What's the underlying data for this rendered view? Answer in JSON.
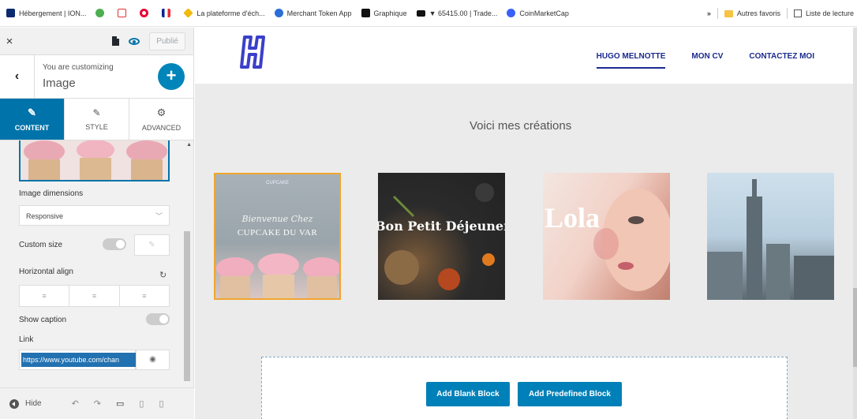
{
  "bookmarks": [
    {
      "label": "Hébergement | ION...",
      "icon": "ionos-icon",
      "color": "#0b2a6f"
    },
    {
      "label": "",
      "icon": "leaf-icon",
      "color": "#4caf50"
    },
    {
      "label": "",
      "icon": "spark-icon",
      "color": "#d33"
    },
    {
      "label": "",
      "icon": "opera-icon",
      "color": "#e03"
    },
    {
      "label": "",
      "icon": "flag-fr-icon",
      "color": "#002395"
    },
    {
      "label": "La plateforme d'éch...",
      "icon": "diamond-icon",
      "color": "#f0b90b"
    },
    {
      "label": "Merchant Token App",
      "icon": "merchant-icon",
      "color": "#2b6ed7"
    },
    {
      "label": "Graphique",
      "icon": "tradingview-icon",
      "color": "#111"
    },
    {
      "label": "▼ 65415.00 | Trade...",
      "icon": "trade-icon",
      "color": "#111"
    },
    {
      "label": "CoinMarketCap",
      "icon": "cmc-icon",
      "color": "#3861fb"
    }
  ],
  "bookmarks_right": {
    "more": "»",
    "other": "Autres favoris",
    "reading": "Liste de lecture"
  },
  "customizer": {
    "close": "×",
    "publish_label": "Publié",
    "you_are_customizing": "You are customizing",
    "current": "Image",
    "back": "‹",
    "add": "+",
    "tabs": [
      {
        "label": "CONTENT",
        "icon": "✎",
        "active": true
      },
      {
        "label": "STYLE",
        "icon": "🖌",
        "active": false
      },
      {
        "label": "ADVANCED",
        "icon": "⚙",
        "active": false
      }
    ],
    "image_dimensions_label": "Image dimensions",
    "image_dimensions_value": "Responsive",
    "custom_size_label": "Custom size",
    "horizontal_align_label": "Horizontal align",
    "show_caption_label": "Show caption",
    "link_label": "Link",
    "link_value": "https://www.youtube.com/chan",
    "hide_label": "Hide"
  },
  "site": {
    "nav": [
      {
        "label": "HUGO MELNOTTE",
        "active": true
      },
      {
        "label": "MON CV",
        "active": false
      },
      {
        "label": "CONTACTEZ MOI",
        "active": false
      }
    ],
    "section_title": "Voici mes créations",
    "gallery": [
      {
        "small": "CUPCAKE",
        "script": "Bienvenue Chez",
        "title": "CUPCAKE DU VAR"
      },
      {
        "title": "Bon Petit Déjeuner"
      },
      {
        "title": "Lola"
      },
      {
        "title": ""
      }
    ],
    "add_blank_block": "Add Blank Block",
    "add_predefined_block": "Add Predefined Block"
  },
  "colors": {
    "accent": "#0073aa",
    "brand_blue": "#1b2a8f",
    "button_blue": "#0080b8",
    "selected_border": "#f0a530"
  }
}
